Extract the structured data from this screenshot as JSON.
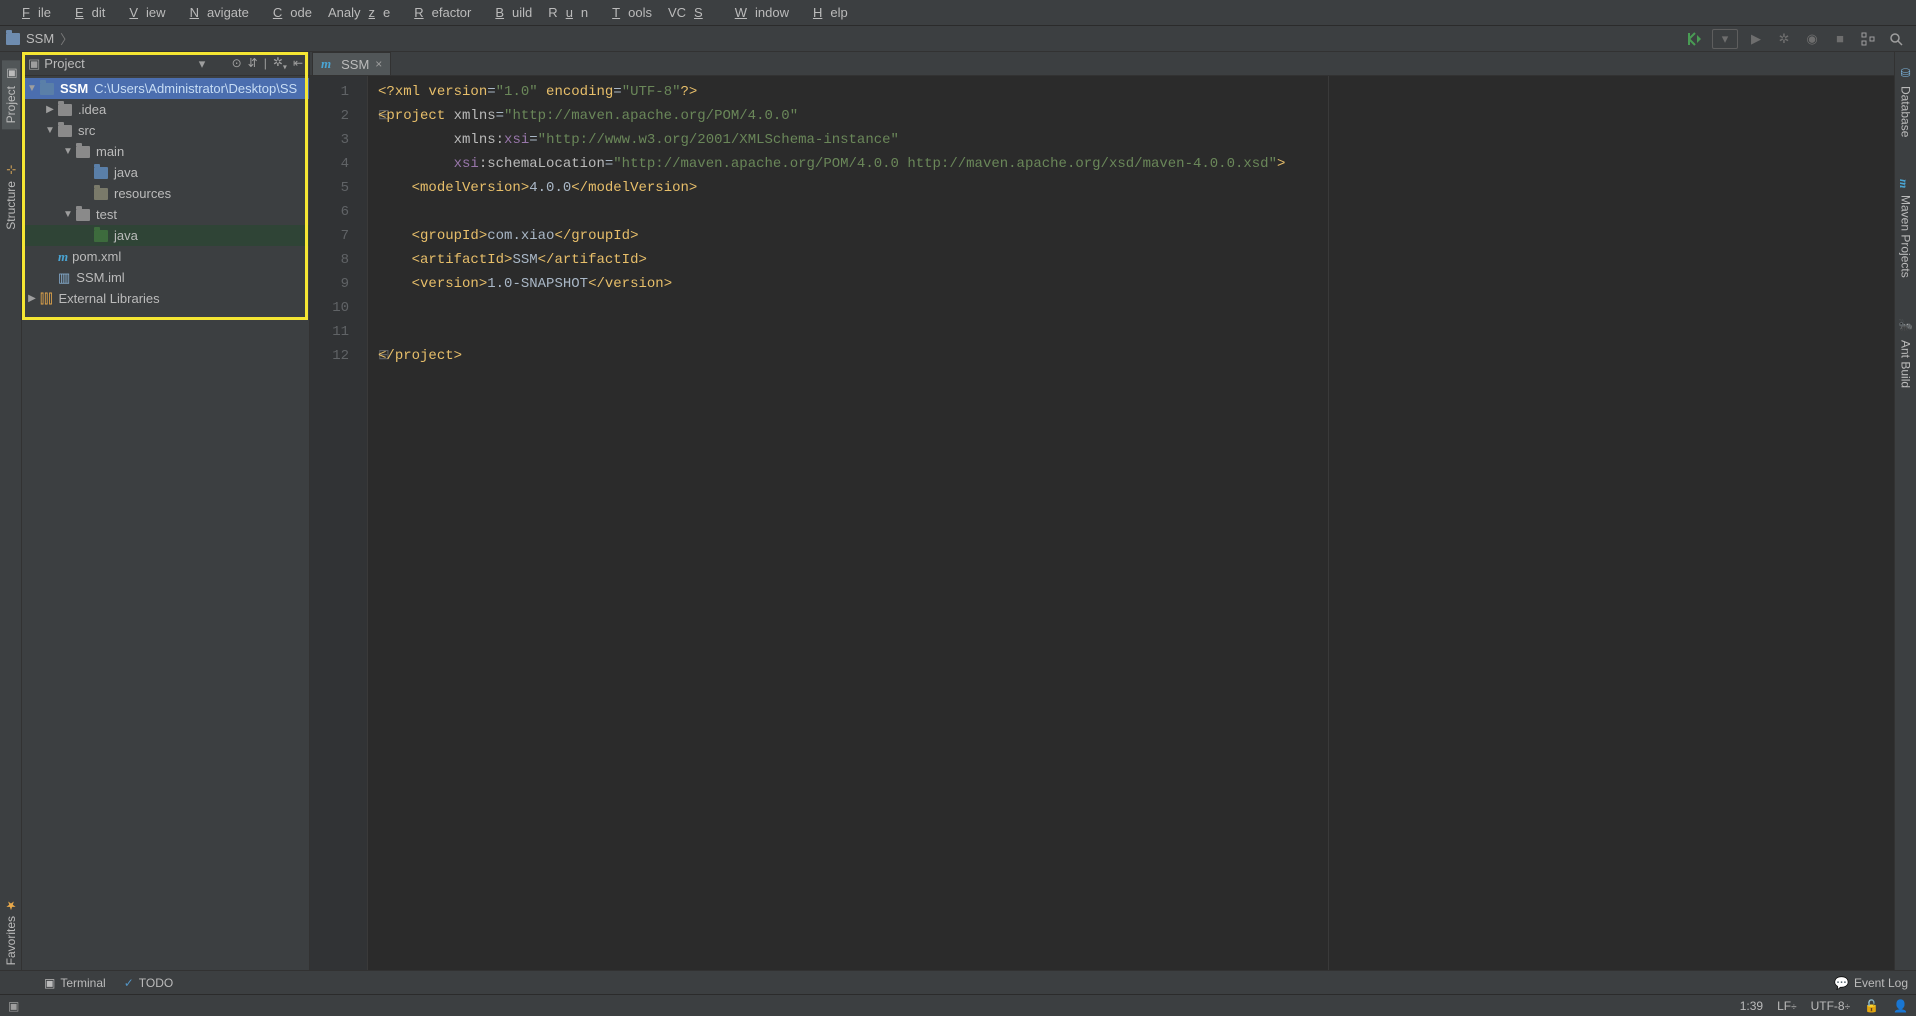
{
  "menu": {
    "items": [
      "File",
      "Edit",
      "View",
      "Navigate",
      "Code",
      "Analyze",
      "Refactor",
      "Build",
      "Run",
      "Tools",
      "VCS",
      "Window",
      "Help"
    ]
  },
  "breadcrumb": {
    "project": "SSM"
  },
  "left_tabs": {
    "project": "Project",
    "structure": "Structure"
  },
  "right_tabs": {
    "database": "Database",
    "maven": "Maven Projects",
    "ant": "Ant Build"
  },
  "left_bottom_tabs": {
    "favorites": "Favorites"
  },
  "project_panel": {
    "title": "Project",
    "root": {
      "name": "SSM",
      "path": "C:\\Users\\Administrator\\Desktop\\SS"
    },
    "nodes": {
      "idea": ".idea",
      "src": "src",
      "main": "main",
      "java1": "java",
      "resources": "resources",
      "test": "test",
      "java2": "java",
      "pom": "pom.xml",
      "iml": "SSM.iml",
      "ext": "External Libraries"
    }
  },
  "editor": {
    "tab_name": "SSM",
    "lines": {
      "l1": {
        "a": "<?",
        "b": "xml version",
        "c": "=",
        "d": "\"1.0\"",
        "e": " encoding",
        "f": "=",
        "g": "\"UTF-8\"",
        "h": "?>"
      },
      "l2": {
        "a": "<",
        "b": "project ",
        "c": "xmlns",
        "d": "=",
        "e": "\"http://maven.apache.org/POM/4.0.0\""
      },
      "l3": {
        "a": "xmlns:",
        "b": "xsi",
        "c": "=",
        "d": "\"http://www.w3.org/2001/XMLSchema-instance\""
      },
      "l4": {
        "a": "xsi",
        "b": ":schemaLocation",
        "c": "=",
        "d": "\"http://maven.apache.org/POM/4.0.0 http://maven.apache.org/xsd/maven-4.0.0.xsd\"",
        "e": ">"
      },
      "l5": {
        "a": "<",
        "b": "modelVersion",
        "c": ">",
        "d": "4.0.0",
        "e": "</",
        "f": "modelVersion",
        "g": ">"
      },
      "l7": {
        "a": "<",
        "b": "groupId",
        "c": ">",
        "d": "com.xiao",
        "e": "</",
        "f": "groupId",
        "g": ">"
      },
      "l8": {
        "a": "<",
        "b": "artifactId",
        "c": ">",
        "d": "SSM",
        "e": "</",
        "f": "artifactId",
        "g": ">"
      },
      "l9": {
        "a": "<",
        "b": "version",
        "c": ">",
        "d": "1.0-SNAPSHOT",
        "e": "</",
        "f": "version",
        "g": ">"
      },
      "l12": {
        "a": "</",
        "b": "project",
        "c": ">"
      }
    }
  },
  "bottom": {
    "terminal": "Terminal",
    "todo": "TODO",
    "eventlog": "Event Log"
  },
  "status": {
    "pos": "1:39",
    "le": "LF",
    "enc": "UTF-8"
  }
}
